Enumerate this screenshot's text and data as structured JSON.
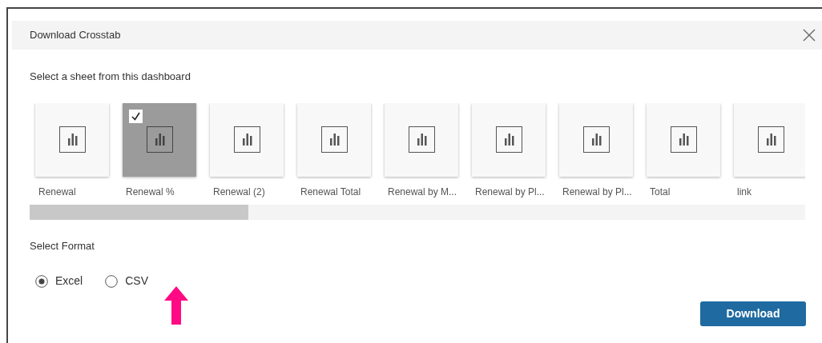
{
  "dialog": {
    "title": "Download Crosstab",
    "sheet_prompt": "Select a sheet from this dashboard",
    "sheets": [
      {
        "label": "Renewal",
        "selected": false
      },
      {
        "label": "Renewal %",
        "selected": true
      },
      {
        "label": "Renewal (2)",
        "selected": false
      },
      {
        "label": "Renewal Total",
        "selected": false
      },
      {
        "label": "Renewal by M...",
        "selected": false
      },
      {
        "label": "Renewal by Pl...",
        "selected": false
      },
      {
        "label": "Renewal by Pl...",
        "selected": false
      },
      {
        "label": "Total",
        "selected": false
      },
      {
        "label": "link",
        "selected": false
      }
    ],
    "format_label": "Select Format",
    "formats": [
      {
        "label": "Excel",
        "selected": true
      },
      {
        "label": "CSV",
        "selected": false
      }
    ],
    "download_button": "Download"
  }
}
